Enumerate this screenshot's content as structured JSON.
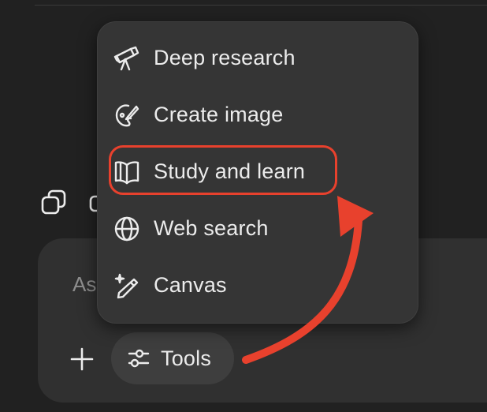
{
  "composer": {
    "placeholder": "Ask anything"
  },
  "tools_button": {
    "label": "Tools",
    "icon": "sliders-icon"
  },
  "tools_menu": {
    "items": [
      {
        "label": "Deep research",
        "icon": "telescope-icon"
      },
      {
        "label": "Create image",
        "icon": "palette-icon"
      },
      {
        "label": "Study and learn",
        "icon": "book-open-icon",
        "highlighted": true
      },
      {
        "label": "Web search",
        "icon": "globe-icon"
      },
      {
        "label": "Canvas",
        "icon": "pencil-sparkle-icon"
      }
    ]
  },
  "annotation": {
    "color": "#e8412d",
    "target": "Study and learn"
  },
  "colors": {
    "background": "#212121",
    "composer": "#303030",
    "menu": "#353535",
    "text": "#ececec",
    "accent": "#e8412d"
  }
}
